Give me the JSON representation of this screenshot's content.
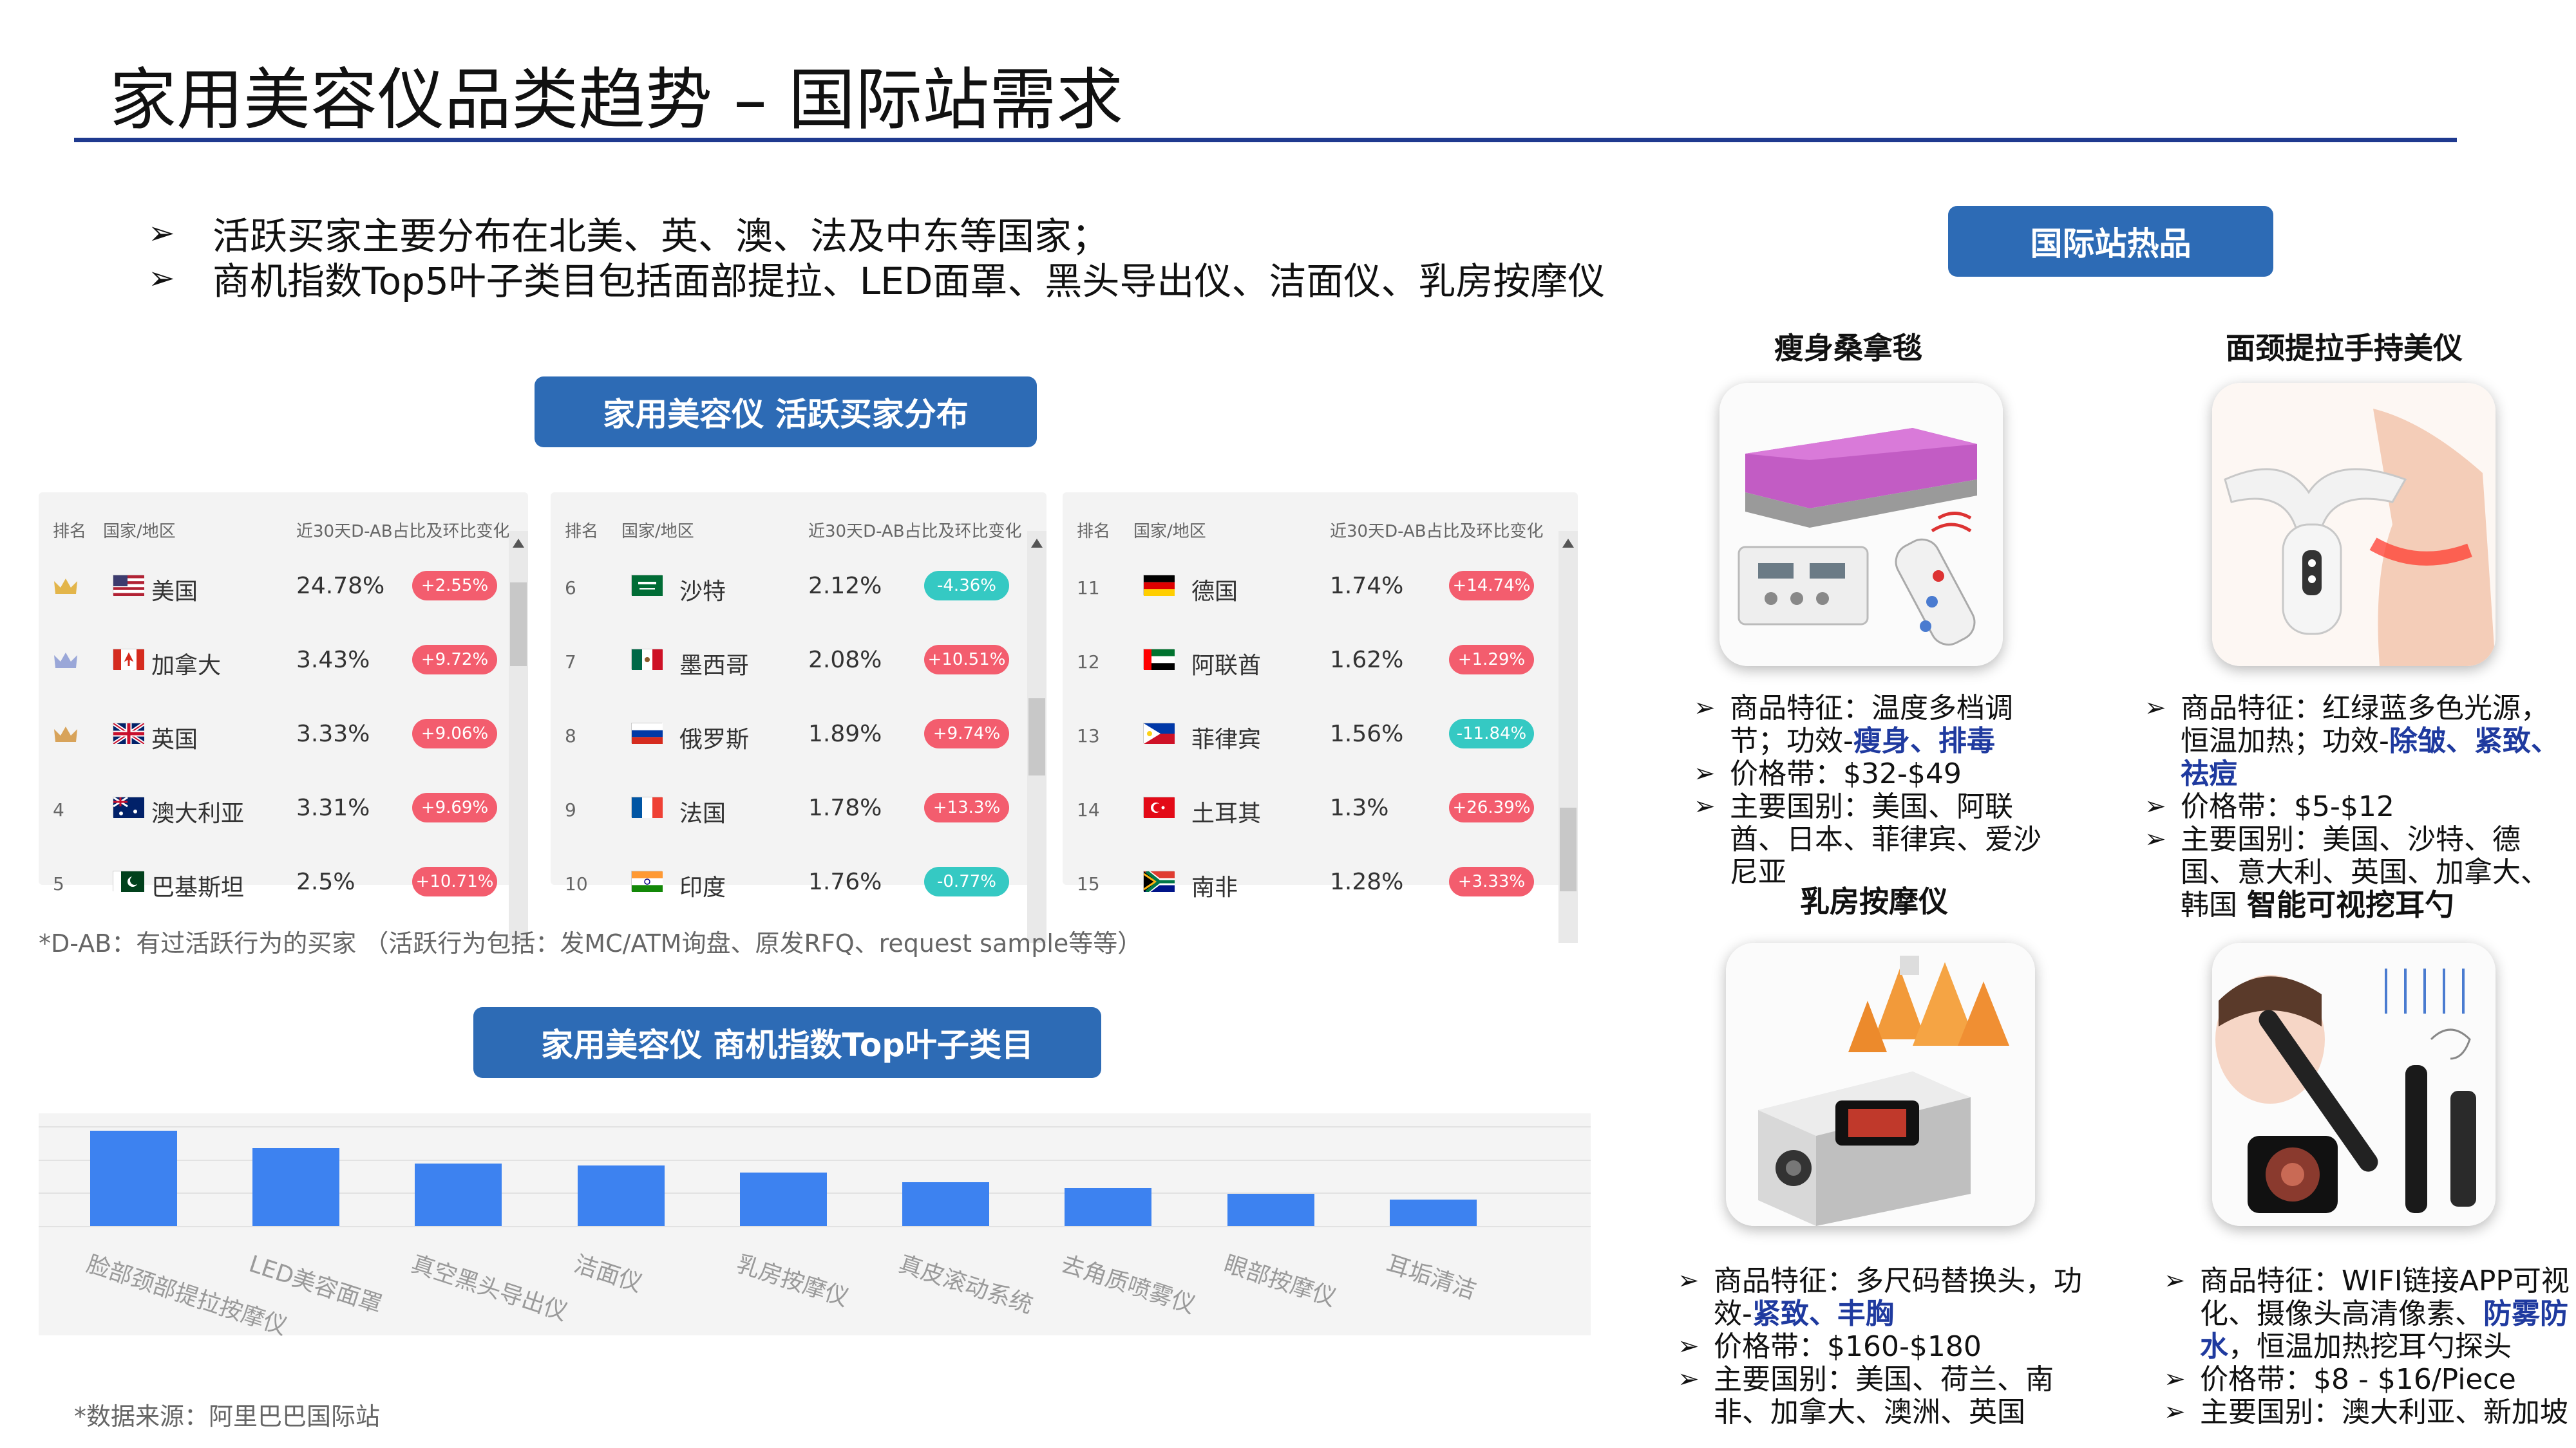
{
  "title": "家用美容仪品类趋势 – 国际站需求",
  "bullets": [
    "活跃买家主要分布在北美、英、澳、法及中东等国家；",
    "商机指数Top5叶子类目包括面部提拉、LED面罩、黑头导出仪、洁面仪、乳房按摩仪"
  ],
  "buyer_section_label": "家用美容仪 活跃买家分布",
  "table_headers": {
    "rank": "排名",
    "country": "国家/地区",
    "share": "近30天D-AB占比及环比变化"
  },
  "buyer_tables": [
    [
      {
        "rank": "crown-gold",
        "country": "美国",
        "share": "24.78%",
        "change": "+2.55%",
        "dir": "up"
      },
      {
        "rank": "crown-silver",
        "country": "加拿大",
        "share": "3.43%",
        "change": "+9.72%",
        "dir": "up"
      },
      {
        "rank": "crown-bronze",
        "country": "英国",
        "share": "3.33%",
        "change": "+9.06%",
        "dir": "up"
      },
      {
        "rank": "4",
        "country": "澳大利亚",
        "share": "3.31%",
        "change": "+9.69%",
        "dir": "up"
      },
      {
        "rank": "5",
        "country": "巴基斯坦",
        "share": "2.5%",
        "change": "+10.71%",
        "dir": "up"
      }
    ],
    [
      {
        "rank": "6",
        "country": "沙特",
        "share": "2.12%",
        "change": "-4.36%",
        "dir": "down"
      },
      {
        "rank": "7",
        "country": "墨西哥",
        "share": "2.08%",
        "change": "+10.51%",
        "dir": "up"
      },
      {
        "rank": "8",
        "country": "俄罗斯",
        "share": "1.89%",
        "change": "+9.74%",
        "dir": "up"
      },
      {
        "rank": "9",
        "country": "法国",
        "share": "1.78%",
        "change": "+13.3%",
        "dir": "up"
      },
      {
        "rank": "10",
        "country": "印度",
        "share": "1.76%",
        "change": "-0.77%",
        "dir": "down"
      }
    ],
    [
      {
        "rank": "11",
        "country": "德国",
        "share": "1.74%",
        "change": "+14.74%",
        "dir": "up"
      },
      {
        "rank": "12",
        "country": "阿联酋",
        "share": "1.62%",
        "change": "+1.29%",
        "dir": "up"
      },
      {
        "rank": "13",
        "country": "菲律宾",
        "share": "1.56%",
        "change": "-11.84%",
        "dir": "down"
      },
      {
        "rank": "14",
        "country": "土耳其",
        "share": "1.3%",
        "change": "+26.39%",
        "dir": "up"
      },
      {
        "rank": "15",
        "country": "南非",
        "share": "1.28%",
        "change": "+3.33%",
        "dir": "up"
      }
    ]
  ],
  "dab_note": "*D-AB：有过活跃行为的买家 （活跃行为包括：发MC/ATM询盘、原发RFQ、request sample等等）",
  "opportunity_section_label": "家用美容仪 商机指数Top叶子类目",
  "chart_data": {
    "type": "bar",
    "categories": [
      "脸部颈部提拉按摩仪",
      "LED美容面罩",
      "真空黑头导出仪",
      "洁面仪",
      "乳房按摩仪",
      "真皮滚动系统",
      "去角质喷雾仪",
      "眼部按摩仪",
      "耳垢清洁"
    ],
    "values": [
      100,
      82,
      66,
      64,
      56,
      46,
      40,
      34,
      28
    ],
    "ylim": [
      0,
      105
    ],
    "grid": true,
    "bar_color": "#3d82f0"
  },
  "source_note": "*数据来源：阿里巴巴国际站",
  "hot_products_label": "国际站热品",
  "products": [
    {
      "name": "瘦身桑拿毯",
      "lines": [
        [
          {
            "t": "商品特征：温度多档调节；功效-"
          },
          {
            "t": "瘦身、排毒",
            "hl": true
          }
        ],
        [
          {
            "t": " 价格带：$32-$49"
          }
        ],
        [
          {
            "t": "主要国别：美国、阿联酋、日本、菲律宾、爱沙尼亚"
          }
        ]
      ]
    },
    {
      "name": "面颈提拉手持美仪",
      "lines": [
        [
          {
            "t": "商品特征：红绿蓝多色光源，恒温加热；功效-"
          },
          {
            "t": "除皱、紧致、祛痘",
            "hl": true
          }
        ],
        [
          {
            "t": "价格带：$5-$12"
          }
        ],
        [
          {
            "t": "主要国别：美国、沙特、德国、意大利、英国、加拿大、韩国"
          }
        ]
      ]
    },
    {
      "name": "乳房按摩仪",
      "lines": [
        [
          {
            "t": "商品特征：多尺码替换头，功效-"
          },
          {
            "t": "紧致、丰胸",
            "hl": true
          }
        ],
        [
          {
            "t": "价格带：$160-$180"
          }
        ],
        [
          {
            "t": "主要国别：美国、荷兰、南非、加拿大、澳洲、英国"
          }
        ]
      ]
    },
    {
      "name": "智能可视挖耳勺",
      "lines": [
        [
          {
            "t": "商品特征：WIFI链接APP可视化、摄像头高清像素、"
          },
          {
            "t": "防雾防水",
            "hl": true
          },
          {
            "t": "，恒温加热挖耳勺探头"
          }
        ],
        [
          {
            "t": "价格带：$8 - $16/Piece"
          }
        ],
        [
          {
            "t": "主要国别：澳大利亚、新加坡"
          }
        ]
      ]
    }
  ],
  "colors": {
    "accent": "#2d6bb5",
    "rule": "#1f3a8f",
    "up": "#f35d6e",
    "down": "#35c9c3",
    "highlight": "#1f3a9f"
  }
}
